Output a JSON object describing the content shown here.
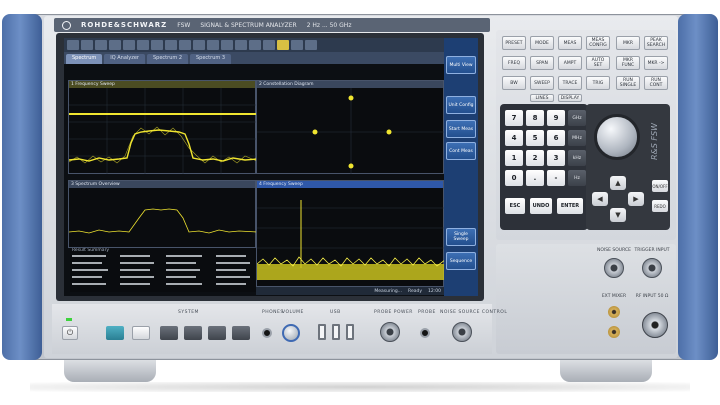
{
  "brand": {
    "name": "ROHDE&SCHWARZ",
    "model": "FSW",
    "description": "SIGNAL & SPECTRUM ANALYZER",
    "range": "2 Hz ... 50 GHz",
    "side_model": "R&S FSW"
  },
  "screen": {
    "tabs": [
      "Spectrum",
      "IQ Analyzer",
      "Spectrum 2",
      "Spectrum 3"
    ],
    "softkeys": [
      "Multi View",
      "Unit Config",
      "Start Meas",
      "Cont Meas",
      "Single Sweep",
      "Sequence"
    ],
    "panes": [
      {
        "title": "1 Frequency Sweep"
      },
      {
        "title": "2 Constellation Diagram"
      },
      {
        "title": "3 Spectrum Overview"
      },
      {
        "title": "4 Frequency Sweep"
      }
    ],
    "table": {
      "headers": [
        "Result Summary",
        "",
        "",
        ""
      ],
      "rows": [
        [
          "",
          "",
          "",
          ""
        ],
        [
          "",
          "",
          "",
          ""
        ],
        [
          "",
          "",
          "",
          ""
        ],
        [
          "",
          "",
          "",
          ""
        ],
        [
          "",
          "",
          "",
          ""
        ]
      ]
    },
    "status": [
      "Measuring...",
      "Ready",
      "12:00"
    ]
  },
  "hardkeys": [
    "PRESET",
    "MODE",
    "MEAS",
    "MEAS CONFIG",
    "FREQ",
    "SPAN",
    "AMPT",
    "AUTO SET",
    "BW",
    "SWEEP",
    "TRACE",
    "TRIG",
    "MKR",
    "PEAK SEARCH",
    "MKR FUNC",
    "MKR ->",
    "RUN SINGLE",
    "RUN CONT",
    "LINES",
    "DISPLAY"
  ],
  "numpad": {
    "keys": [
      "7",
      "8",
      "9",
      "4",
      "5",
      "6",
      "1",
      "2",
      "3",
      "0",
      ".",
      "-"
    ],
    "units": [
      "GHz",
      "MHz",
      "kHz",
      "Hz"
    ],
    "bottom": [
      "ESC",
      "UNDO",
      "ENTER"
    ]
  },
  "nav": {
    "arrows": [
      "▲",
      "◀",
      "▶",
      "▼"
    ],
    "side": [
      "ON/OFF",
      "REDO"
    ]
  },
  "connectors": {
    "labels": [
      "NOISE SOURCE",
      "TRIGGER INPUT",
      "EXT MIXER",
      "RF INPUT 50 Ω"
    ]
  },
  "bottom": {
    "labels": [
      "SYSTEM",
      "PHONES",
      "VOLUME",
      "USB",
      "PROBE POWER",
      "PROBE",
      "NOISE SOURCE CONTROL"
    ],
    "power_symbol": "⏻"
  }
}
